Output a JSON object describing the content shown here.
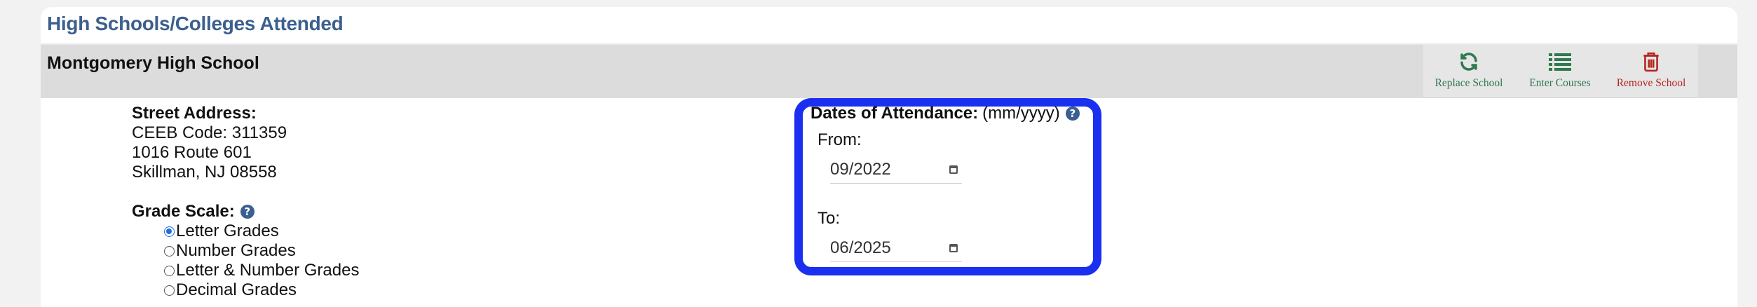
{
  "section": {
    "title": "High Schools/Colleges Attended"
  },
  "school": {
    "name": "Montgomery High School"
  },
  "actions": [
    {
      "label": "Replace School",
      "icon": "refresh-icon",
      "color": "#2f7a4e"
    },
    {
      "label": "Enter Courses",
      "icon": "list-icon",
      "color": "#2f7a4e"
    },
    {
      "label": "Remove School",
      "icon": "trash-icon",
      "color": "#b3261e"
    }
  ],
  "address": {
    "heading": "Street Address:",
    "ceeb": "CEEB Code: 311359",
    "line1": "1016 Route 601",
    "line2": "Skillman, NJ 08558"
  },
  "grade_scale": {
    "heading": "Grade Scale:",
    "options": [
      {
        "label": "Letter Grades",
        "checked": true
      },
      {
        "label": "Number Grades",
        "checked": false
      },
      {
        "label": "Letter & Number Grades",
        "checked": false
      },
      {
        "label": "Decimal Grades",
        "checked": false
      }
    ]
  },
  "dates": {
    "heading": "Dates of Attendance:",
    "format": "(mm/yyyy)",
    "from_label": "From:",
    "from_value": "09/2022",
    "to_label": "To:",
    "to_value": "06/2025"
  },
  "colors": {
    "accent": "#3b5f8f",
    "highlight": "#1a2ff0",
    "bar": "#dcdcdc"
  }
}
